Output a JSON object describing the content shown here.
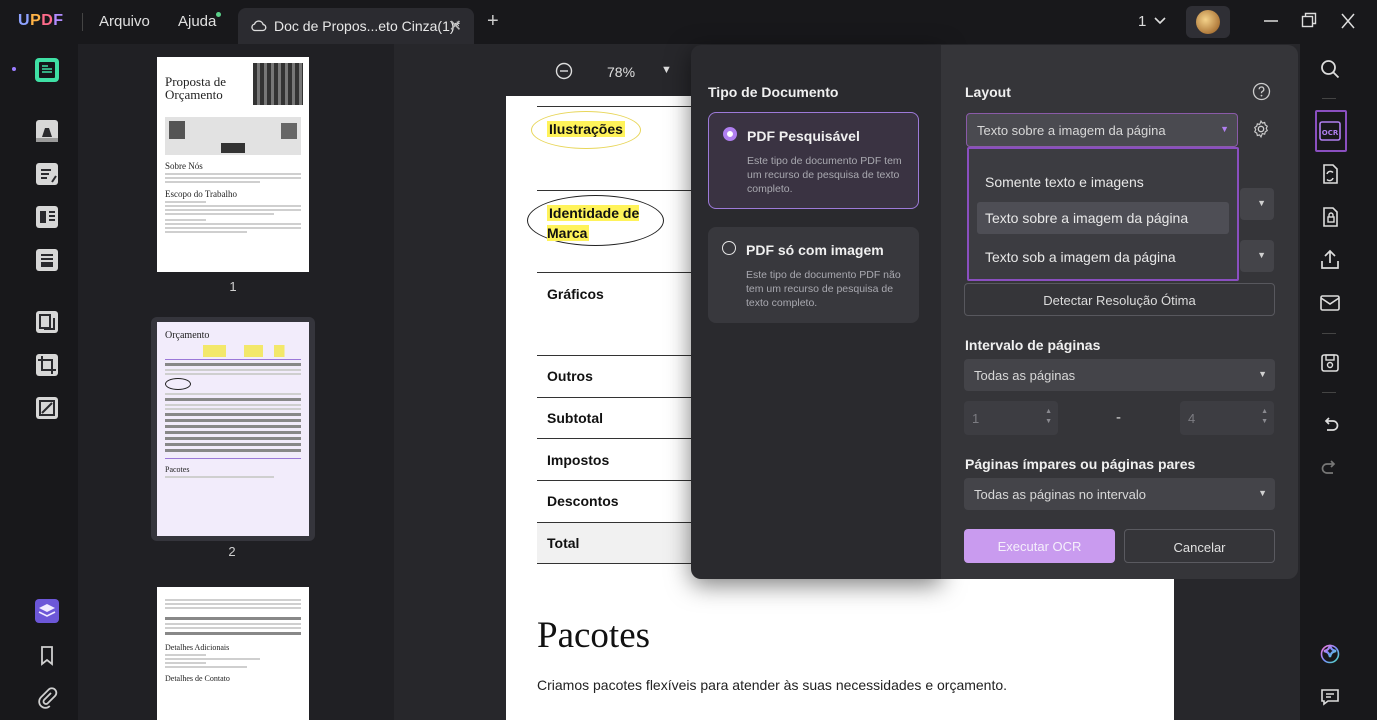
{
  "app": {
    "logo": "UPDF",
    "menu": [
      "Arquivo",
      "Ajuda"
    ],
    "tab_title": "Doc de Propos...eto Cinza(1)*",
    "page_indicator": "1"
  },
  "thumbnails": {
    "pages": [
      "1",
      "2"
    ],
    "page1": {
      "title": "Proposta de Orçamento",
      "sections": [
        "Sobre Nós",
        "Escopo do Trabalho"
      ]
    },
    "page2": {
      "title": "Orçamento",
      "section": "Pacotes"
    },
    "page3": {
      "sections": [
        "Detalhes Adicionais",
        "Detalhes de Contato"
      ]
    }
  },
  "document": {
    "zoom": "78%",
    "rows": [
      "Ilustrações",
      "Identidade de Marca",
      "Gráficos",
      "Outros",
      "Subtotal",
      "Impostos",
      "Descontos",
      "Total"
    ],
    "heading": "Pacotes",
    "paragraph": "Criamos pacotes flexíveis para atender às suas necessidades e orçamento."
  },
  "ocr": {
    "doc_type_title": "Tipo de Documento",
    "options": [
      {
        "title": "PDF Pesquisável",
        "desc": "Este tipo de documento PDF tem um recurso de pesquisa de texto completo.",
        "selected": true
      },
      {
        "title": "PDF só com imagem",
        "desc": "Este tipo de documento PDF não tem um recurso de pesquisa de texto completo.",
        "selected": false
      }
    ],
    "layout_title": "Layout",
    "layout_selected": "Texto sobre a imagem da página",
    "layout_options": [
      "Somente texto e imagens",
      "Texto sobre a imagem da página",
      "Texto sob a imagem da página"
    ],
    "detect_button": "Detectar Resolução Ótima",
    "page_range_title": "Intervalo de páginas",
    "page_range_value": "Todas as páginas",
    "range_from": "1",
    "range_to": "4",
    "range_dash": "-",
    "odd_even_title": "Páginas ímpares ou páginas pares",
    "odd_even_value": "Todas as páginas no intervalo",
    "run_button": "Executar OCR",
    "cancel_button": "Cancelar"
  },
  "colors": {
    "accent": "#b07ff0",
    "highlight_border": "#8a4fc0",
    "background": "#0f0f12"
  }
}
